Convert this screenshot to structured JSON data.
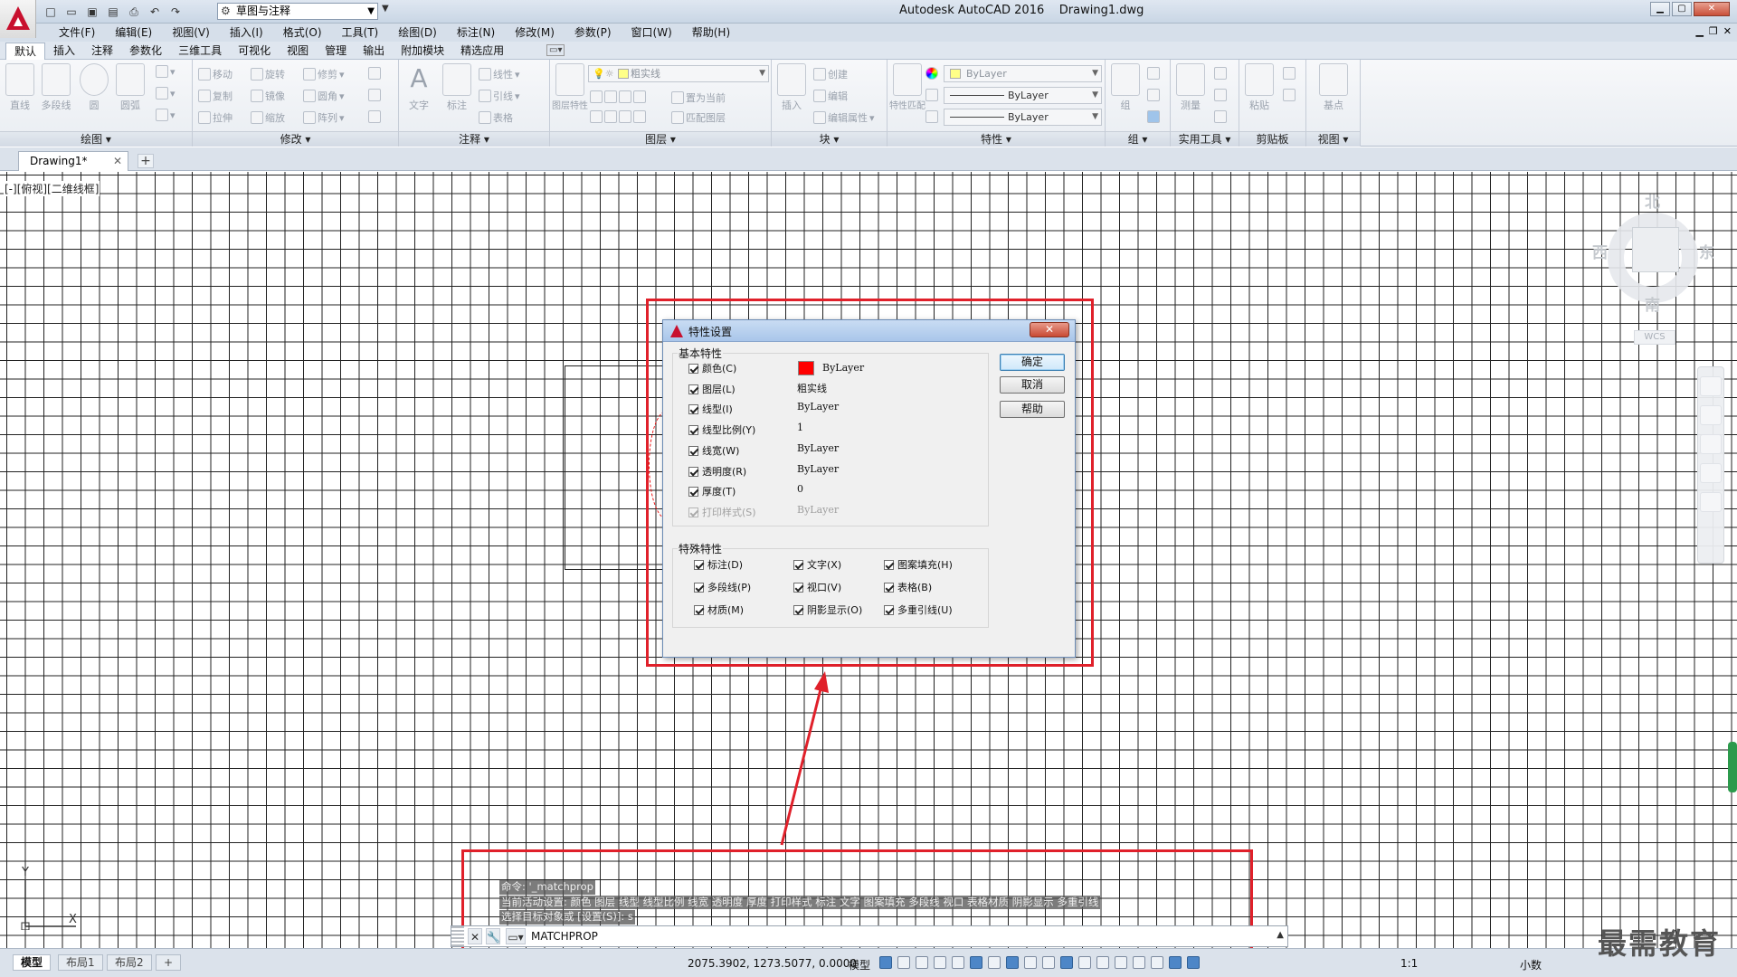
{
  "titlebar": {
    "app_title": "Autodesk AutoCAD 2016    Drawing1.dwg",
    "workspace": "草图与注释"
  },
  "menubar": {
    "items": [
      "文件(F)",
      "编辑(E)",
      "视图(V)",
      "插入(I)",
      "格式(O)",
      "工具(T)",
      "绘图(D)",
      "标注(N)",
      "修改(M)",
      "参数(P)",
      "窗口(W)",
      "帮助(H)"
    ]
  },
  "ribbon_tabs": {
    "items": [
      "默认",
      "插入",
      "注释",
      "参数化",
      "三维工具",
      "可视化",
      "视图",
      "管理",
      "输出",
      "附加模块",
      "精选应用"
    ]
  },
  "ribbon": {
    "draw": {
      "title": "绘图",
      "line": "直线",
      "polyline": "多段线",
      "circle": "圆",
      "arc": "圆弧"
    },
    "modify": {
      "title": "修改",
      "move": "移动",
      "rotate": "旋转",
      "trim": "修剪",
      "copy": "复制",
      "mirror": "镜像",
      "fillet": "圆角",
      "stretch": "拉伸",
      "scale": "缩放",
      "array": "阵列"
    },
    "annotation": {
      "title": "注释",
      "text": "文字",
      "dimension": "标注",
      "linear": "线性",
      "leader": "引线",
      "table": "表格"
    },
    "layers": {
      "title": "图层",
      "props": "图层特性",
      "current_layer": "粗实线",
      "set_current": "置为当前",
      "match_layer": "匹配图层"
    },
    "block": {
      "title": "块",
      "insert": "插入",
      "create": "创建",
      "edit": "编辑",
      "edit_attr": "编辑属性"
    },
    "properties": {
      "title": "特性",
      "match": "特性匹配",
      "color": "ByLayer",
      "linetype": "ByLayer",
      "lineweight": "ByLayer"
    },
    "groups": {
      "title": "组",
      "group": "组"
    },
    "utilities": {
      "title": "实用工具",
      "measure": "测量"
    },
    "clipboard": {
      "title": "剪贴板",
      "paste": "粘贴"
    },
    "view": {
      "title": "视图",
      "base": "基点"
    }
  },
  "file_tab": {
    "name": "Drawing1*"
  },
  "viewport_label": "[-][俯视][二维线框]",
  "viewcube": {
    "north": "北",
    "south": "南",
    "east": "东",
    "west": "西",
    "wcs": "WCS"
  },
  "dialog": {
    "title": "特性设置",
    "basic_group": "基本特性",
    "basic": [
      {
        "label": "颜色(C)",
        "value": "ByLayer",
        "checked": true
      },
      {
        "label": "图层(L)",
        "value": "粗实线",
        "checked": true
      },
      {
        "label": "线型(I)",
        "value": "ByLayer",
        "checked": true
      },
      {
        "label": "线型比例(Y)",
        "value": "1",
        "checked": true
      },
      {
        "label": "线宽(W)",
        "value": "ByLayer",
        "checked": true
      },
      {
        "label": "透明度(R)",
        "value": "ByLayer",
        "checked": true
      },
      {
        "label": "厚度(T)",
        "value": "0",
        "checked": true
      },
      {
        "label": "打印样式(S)",
        "value": "ByLayer",
        "checked": true,
        "disabled": true
      }
    ],
    "color_swatch": "#ff0000",
    "special_group": "特殊特性",
    "special": [
      [
        "标注(D)",
        "文字(X)",
        "图案填充(H)"
      ],
      [
        "多段线(P)",
        "视口(V)",
        "表格(B)"
      ],
      [
        "材质(M)",
        "阴影显示(O)",
        "多重引线(U)"
      ]
    ],
    "ok": "确定",
    "cancel": "取消",
    "help": "帮助"
  },
  "command": {
    "history": [
      "命令: '_matchprop",
      "当前活动设置:  颜色 图层 线型 线型比例 线宽 透明度 厚度 打印样式 标注 文字 图案填充 多段线 视口 表格材质 阴影显示 多重引线",
      "选择目标对象或 [设置(S)]: s"
    ],
    "current": "MATCHPROP"
  },
  "status": {
    "layouts": [
      "模型",
      "布局1",
      "布局2"
    ],
    "coords": "2075.3902, 1273.5077, 0.0000",
    "model": "模型",
    "scale": "1:1",
    "units": "小数"
  },
  "watermark": "最需教育",
  "colors": {
    "accent_red": "#e0202a",
    "autocad_red": "#c8102e"
  }
}
